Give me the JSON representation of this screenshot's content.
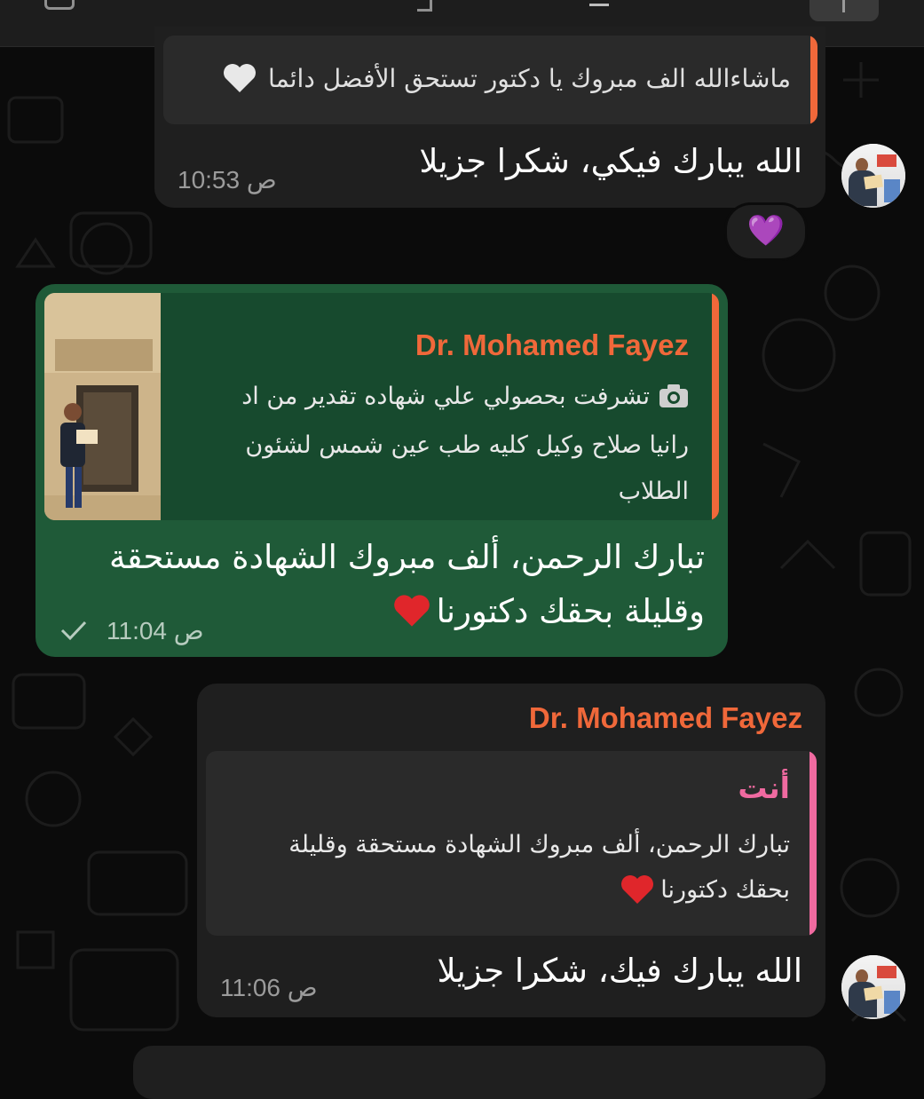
{
  "messages": [
    {
      "direction": "incoming",
      "quote_text": "ماشاءالله الف مبروك يا دكتور تستحق الأفضل دائما",
      "quote_icon": "white-heart-icon",
      "text": "الله يبارك فيكي، شكرا جزيلا",
      "time": "10:53 ص",
      "reaction": "💜"
    },
    {
      "direction": "outgoing",
      "reply_sender": "Dr. Mohamed Fayez",
      "reply_icon": "camera-icon",
      "reply_lines": [
        "تشرفت بحصولي علي شهاده تقدير من اد",
        "رانيا صلاح وكيل كليه طب عين شمس لشئون",
        "الطلاب"
      ],
      "text_lines": [
        "تبارك الرحمن، ألف مبروك الشهادة مستحقة",
        "وقليلة بحقك دكتورنا"
      ],
      "emoji_icon": "red-heart-icon",
      "time": "11:04 ص",
      "status_icon": "single-check-icon"
    },
    {
      "direction": "incoming",
      "sender": "Dr. Mohamed Fayez",
      "reply_sender": "أنت",
      "reply_lines": [
        "تبارك الرحمن، ألف مبروك الشهادة مستحقة وقليلة",
        "بحقك دكتورنا"
      ],
      "reply_emoji_icon": "red-heart-icon",
      "text": "الله يبارك فيك، شكرا جزيلا",
      "time": "11:06 ص"
    }
  ],
  "colors": {
    "background": "#0b0b0b",
    "incoming_bubble": "#1f1f1f",
    "outgoing_bubble": "#1f5a38",
    "sender_name": "#f0683a",
    "self_reply_name": "#f06aa0"
  }
}
